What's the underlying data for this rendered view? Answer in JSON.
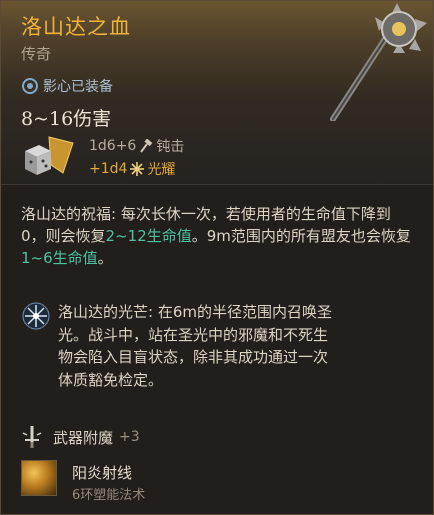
{
  "item": {
    "name": "洛山达之血",
    "rarity": "传奇",
    "equipped_label": "影心已装备",
    "damage": "8~16伤害",
    "damage_line1": "1d6+6",
    "damage_type1": "钝击",
    "damage_line2": "+1d4",
    "damage_type2": "光耀"
  },
  "blessing": {
    "title": "洛山达的祝福:",
    "text_a": " 每次长休一次，若使用者的生命值下降到0，则会恢复",
    "heal_self": "2~12生命值",
    "text_b": "。9m范围内的所有盟友也会恢复",
    "heal_allies": "1~6生命值",
    "text_c": "。"
  },
  "aura": {
    "title": "洛山达的光芒:",
    "text": " 在6m的半径范围内召唤圣光。战斗中，站在圣光中的邪魔和不死生物会陷入目盲状态，除非其成功通过一次体质豁免检定。"
  },
  "enchant": {
    "label": "武器附魔",
    "bonus": "+3"
  },
  "spell": {
    "name": "阳炎射线",
    "level": "6环塑能法术"
  },
  "colors": {
    "title_gold": "#f0b23a",
    "radiant": "#e1a83a",
    "heal_green": "#4fc2a4"
  }
}
